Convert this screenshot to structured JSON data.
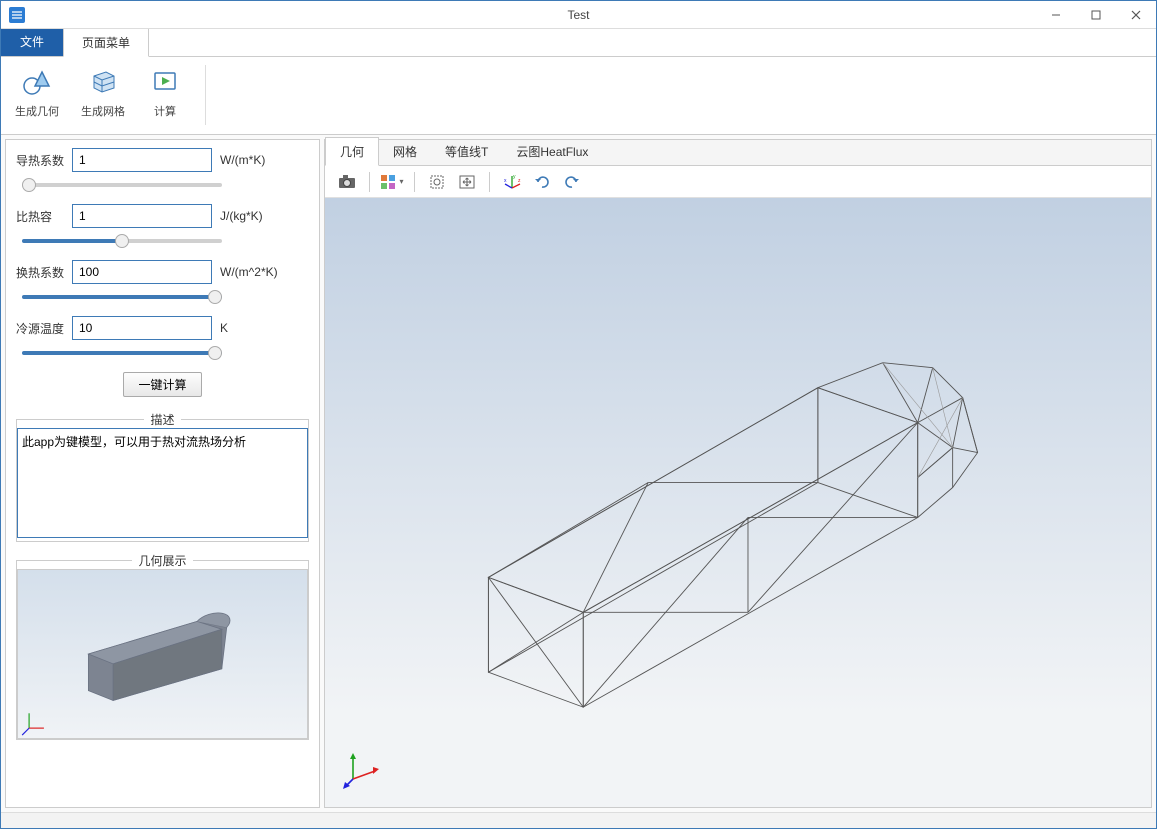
{
  "window": {
    "title": "Test"
  },
  "menu": {
    "file": "文件",
    "page": "页面菜单"
  },
  "ribbon": {
    "gen_geometry": "生成几何",
    "gen_mesh": "生成网格",
    "compute": "计算"
  },
  "sidebar": {
    "params": {
      "thermal_conductivity": {
        "label": "导热系数",
        "value": "1",
        "unit": "W/(m*K)"
      },
      "specific_heat": {
        "label": "比热容",
        "value": "1",
        "unit": "J/(kg*K)"
      },
      "heat_transfer_coef": {
        "label": "换热系数",
        "value": "100",
        "unit": "W/(m^2*K)"
      },
      "cold_source_temp": {
        "label": "冷源温度",
        "value": "10",
        "unit": "K"
      }
    },
    "one_click_compute": "一键计算",
    "description_legend": "描述",
    "description_text": "此app为键模型，可以用于热对流热场分析",
    "geometry_legend": "几何展示"
  },
  "main": {
    "tabs": {
      "geometry": "几何",
      "mesh": "网格",
      "isoline": "等值线T",
      "cloud": "云图HeatFlux"
    }
  },
  "icons": {
    "camera": "camera",
    "views": "views",
    "zoom_extents": "zoom-extents",
    "pan": "pan",
    "axis": "axis",
    "rotate_cw": "rotate-cw",
    "rotate_ccw": "rotate-ccw"
  }
}
